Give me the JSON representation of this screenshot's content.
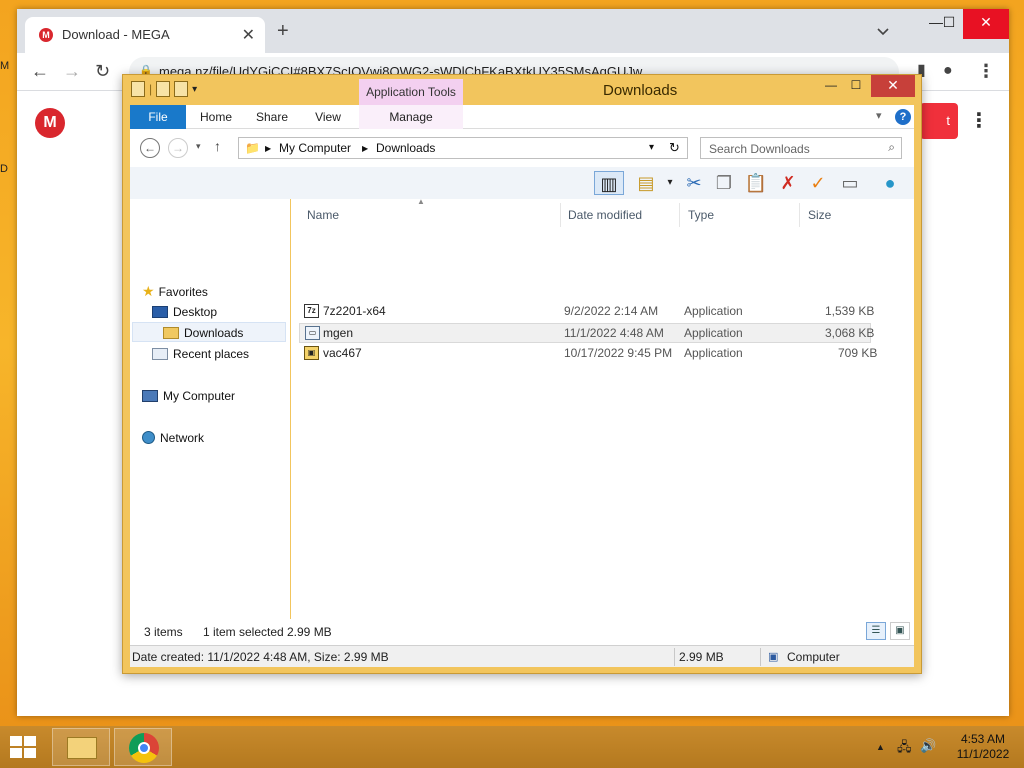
{
  "desktop": {
    "edge_top": "M",
    "edge_mid": "D"
  },
  "browser": {
    "tab_title": "Download - MEGA",
    "tab_favicon": "M",
    "url": "mega.nz/file/UdYGiCCI#8BX7ScIOVwj8OWG2-sWDlChFKaBXtkUY35SMsAqGUJw",
    "mega_logo": "M",
    "red_button_text": "t"
  },
  "explorer": {
    "title": "Downloads",
    "contextual_tab": "Application Tools",
    "ribbon_tabs": [
      "File",
      "Home",
      "Share",
      "View",
      "Manage"
    ],
    "breadcrumb": [
      "My Computer",
      "Downloads"
    ],
    "search_placeholder": "Search Downloads",
    "nav": {
      "favorites": "Favorites",
      "desktop": "Desktop",
      "downloads": "Downloads",
      "recent": "Recent places",
      "computer": "My Computer",
      "network": "Network"
    },
    "columns": {
      "name": "Name",
      "date": "Date modified",
      "type": "Type",
      "size": "Size"
    },
    "files": [
      {
        "name": "7z2201-x64",
        "date": "9/2/2022 2:14 AM",
        "type": "Application",
        "size": "1,539 KB",
        "icon": "7z-icon"
      },
      {
        "name": "mgen",
        "date": "11/1/2022 4:48 AM",
        "type": "Application",
        "size": "3,068 KB",
        "icon": "app-window-icon",
        "selected": true
      },
      {
        "name": "vac467",
        "date": "10/17/2022 9:45 PM",
        "type": "Application",
        "size": "709 KB",
        "icon": "installer-icon"
      }
    ],
    "status": {
      "items": "3 items",
      "selected": "1 item selected",
      "selected_size": "2.99 MB",
      "details": "Date created: 11/1/2022 4:48 AM, Size: 2.99 MB",
      "size": "2.99 MB",
      "location": "Computer"
    }
  },
  "taskbar": {
    "time": "4:53 AM",
    "date": "11/1/2022"
  }
}
